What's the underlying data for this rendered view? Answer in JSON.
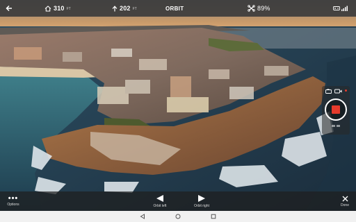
{
  "topbar": {
    "back_icon": "back-arrow-icon",
    "distance": {
      "icon": "home-icon",
      "value": "310",
      "unit": "FT"
    },
    "altitude": {
      "icon": "up-arrow-icon",
      "value": "202",
      "unit": "FT"
    },
    "mode": "ORBIT",
    "battery": {
      "icon": "drone-icon",
      "value": "89%"
    },
    "signal": {
      "icons": [
        "controller-icon",
        "signal-bars-icon"
      ]
    }
  },
  "camera_panel": {
    "icons": [
      "camera-icon",
      "video-icon"
    ],
    "record_button": {
      "state": "recording",
      "color": "#e53b2c"
    }
  },
  "controls": {
    "options": {
      "label": "Options",
      "icon": "more-dots-icon"
    },
    "orbit_left": {
      "label": "Orbit left",
      "icon": "play-left-icon"
    },
    "orbit_right": {
      "label": "Orbit right",
      "icon": "play-right-icon"
    },
    "done": {
      "label": "Done",
      "icon": "close-icon"
    }
  },
  "navbar": {
    "back": "nav-back-icon",
    "home": "nav-home-icon",
    "recents": "nav-recents-icon"
  }
}
